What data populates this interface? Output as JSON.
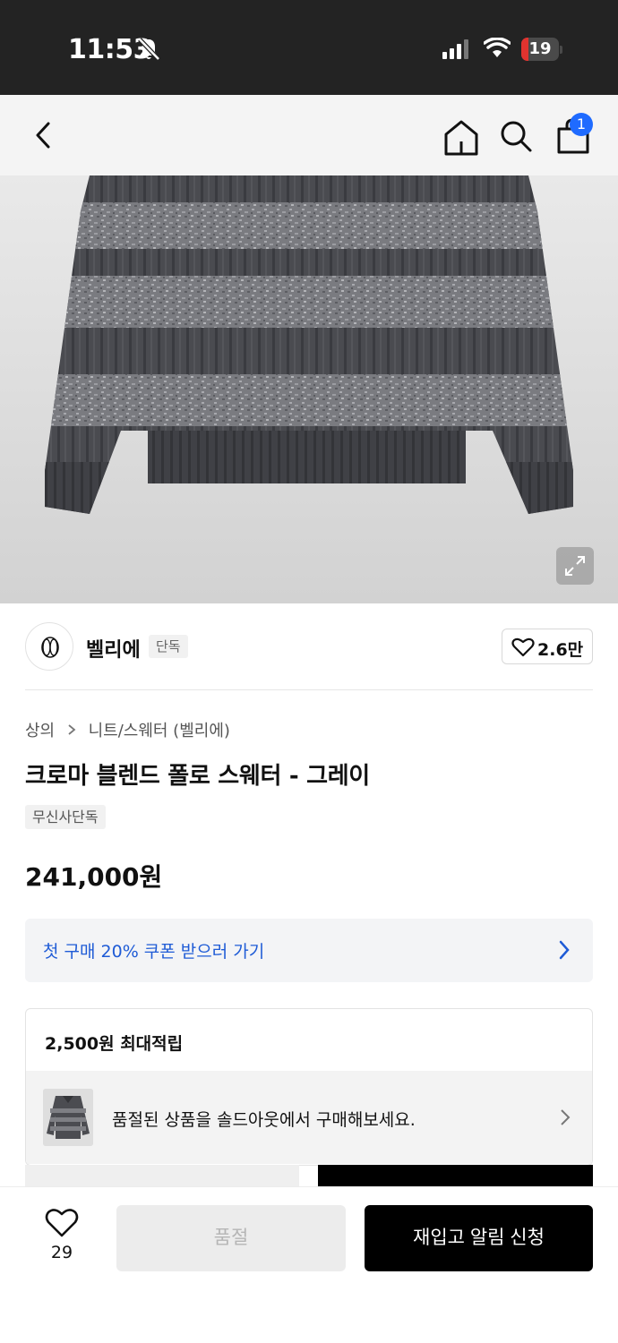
{
  "status_bar": {
    "time": "11:53",
    "battery_level": "19",
    "battery_fraction": 0.19
  },
  "nav": {
    "cart_count": "1",
    "icons": [
      "back-icon",
      "home-icon",
      "search-icon",
      "bag-icon"
    ]
  },
  "brand": {
    "name": "벨리에",
    "exclusive_tag": "단독",
    "like_count": "2.6만"
  },
  "breadcrumb": [
    "상의",
    "니트/스웨터 (벨리에)"
  ],
  "product": {
    "title": "크로마 블렌드 폴로 스웨터 - 그레이",
    "tag": "무신사단독",
    "price": "241,000원"
  },
  "coupon": {
    "text": "첫 구매 20% 쿠폰 받으러 가기"
  },
  "points": {
    "text": "2,500원 최대적립"
  },
  "soldout_suggestion": {
    "text": "품절된 상품을 솔드아웃에서 구매해보세요."
  },
  "bottom": {
    "wish_count": "29",
    "soldout_label": "품절",
    "restock_label": "재입고 알림 신청"
  },
  "colors": {
    "accent_blue": "#1f6bff",
    "coupon_text": "#1e5bd6",
    "battery_red": "#e0332f"
  }
}
